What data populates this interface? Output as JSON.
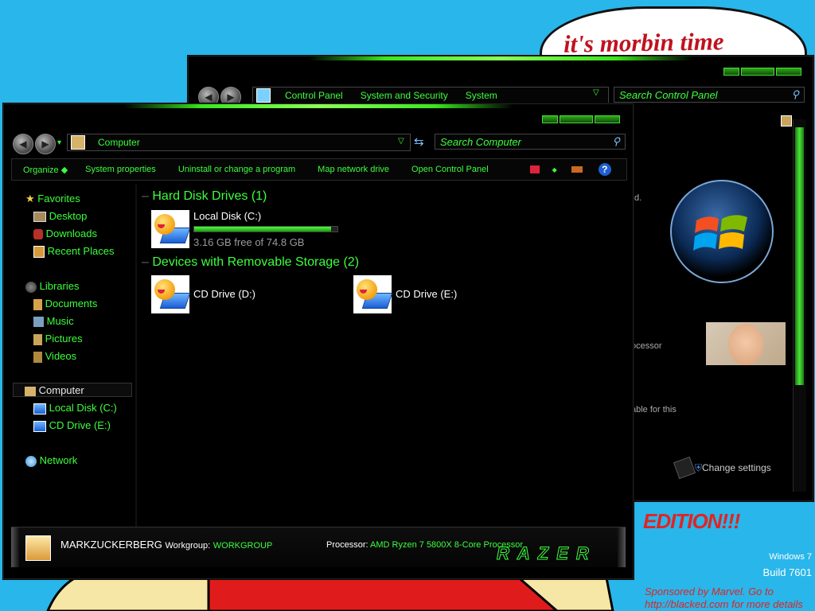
{
  "desktop": {
    "bubble_text": "it's morbin  time",
    "special_text": "EDITION!!!",
    "os_name": "Windows 7",
    "build": "Build 7601",
    "sponsor": "Sponsored by Marvel. Go to http://blacked.com for more details"
  },
  "back_window": {
    "breadcrumb": [
      "Control Panel",
      "System and Security",
      "System"
    ],
    "search_placeholder": "Search Control Panel",
    "partial_texts": [
      "d.",
      "ocessor",
      "able for this"
    ],
    "change_settings": "Change settings"
  },
  "front_window": {
    "address": "Computer",
    "search_placeholder": "Search Computer",
    "toolbar": [
      "Organize",
      "System properties",
      "Uninstall or change a program",
      "Map network drive",
      "Open Control Panel"
    ],
    "sidebar": {
      "favorites": {
        "label": "Favorites",
        "items": [
          "Desktop",
          "Downloads",
          "Recent Places"
        ]
      },
      "libraries": {
        "label": "Libraries",
        "items": [
          "Documents",
          "Music",
          "Pictures",
          "Videos"
        ]
      },
      "computer": {
        "label": "Computer",
        "items": [
          "Local Disk (C:)",
          "CD Drive (E:)"
        ]
      },
      "network": "Network"
    },
    "groups": {
      "hdd": {
        "title": "Hard Disk Drives (1)",
        "drive_name": "Local Disk (C:)",
        "free_text": "3.16 GB free of 74.8 GB",
        "used_fraction": 0.958
      },
      "removable": {
        "title": "Devices with Removable Storage (2)",
        "drives": [
          "CD Drive (D:)",
          "CD Drive (E:)"
        ]
      }
    },
    "status": {
      "computer_name": "MARKZUCKERBERG",
      "workgroup_label": "Workgroup:",
      "workgroup_value": "WORKGROUP",
      "processor_label": "Processor:",
      "processor_value": "AMD Ryzen 7 5800X 8-Core Processor",
      "brand": "RAZER"
    }
  },
  "colors": {
    "accent": "#3cff3c",
    "desktop": "#29b6ea",
    "window": "#000000"
  }
}
